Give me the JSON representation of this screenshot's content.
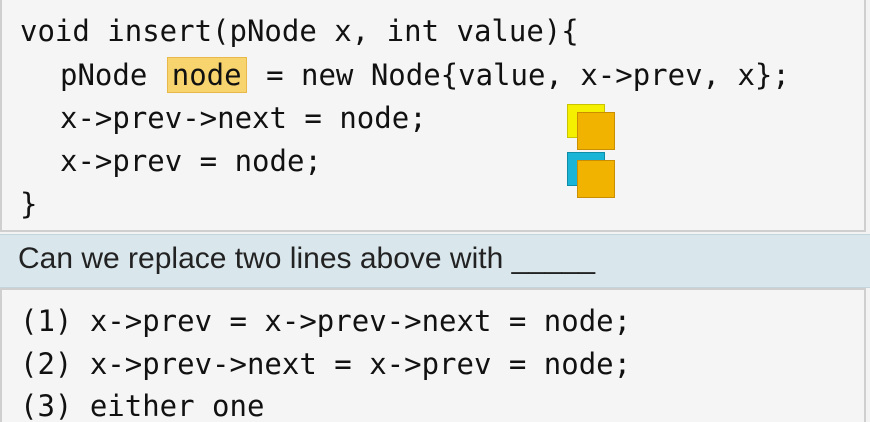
{
  "code": {
    "line1": "void insert(pNode x, int value){",
    "line2_prefix": "pNode ",
    "line2_highlight": "node",
    "line2_suffix": " = new Node{value, x->prev, x};",
    "line3": "x->prev->next = node;",
    "line4": "x->prev = node;",
    "line5": "}"
  },
  "question": {
    "text": "Can we replace two lines above with _____"
  },
  "options": [
    "(1) x->prev = x->prev->next = node;",
    "(2) x->prev->next = x->prev = node;",
    "(3) either one"
  ],
  "colors": {
    "highlight": "#f7d46e",
    "question_bar": "#d9e6ec",
    "icon_front": "#f2b200",
    "icon_back_yellow": "#f4f000",
    "icon_back_cyan": "#19b4d6"
  },
  "icons": [
    "yellow-orange-square-icon",
    "cyan-orange-square-icon"
  ]
}
